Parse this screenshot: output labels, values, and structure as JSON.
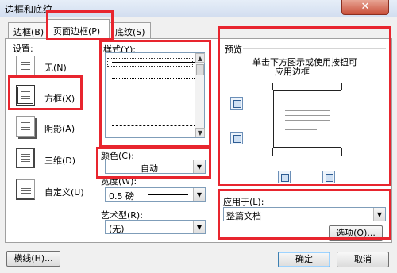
{
  "window": {
    "title": "边框和底纹",
    "close_glyph": "✕"
  },
  "tabs": [
    {
      "label": "边框(B)",
      "active": false
    },
    {
      "label": "页面边框(P)",
      "active": true
    },
    {
      "label": "底纹(S)",
      "active": false
    }
  ],
  "settings": {
    "heading": "设置:",
    "items": [
      {
        "label": "无(N)",
        "icon": "none-border-icon"
      },
      {
        "label": "方框(X)",
        "icon": "box-border-icon",
        "selected": true
      },
      {
        "label": "阴影(A)",
        "icon": "shadow-border-icon"
      },
      {
        "label": "三维(D)",
        "icon": "3d-border-icon"
      },
      {
        "label": "自定义(U)",
        "icon": "custom-border-icon"
      }
    ]
  },
  "line_style": {
    "label": "样式(Y):"
  },
  "color": {
    "label": "颜色(C):",
    "value": "自动"
  },
  "width": {
    "label": "宽度(W):",
    "value": "0.5 磅"
  },
  "art": {
    "label": "艺术型(R):",
    "value": "(无)"
  },
  "preview": {
    "heading": "预览",
    "hint_line1": "单击下方图示或使用按钮可",
    "hint_line2": "应用边框"
  },
  "apply_to": {
    "label": "应用于(L):",
    "value": "整篇文档",
    "options_button": "选项(O)..."
  },
  "footer": {
    "horizontal_line_button": "横线(H)...",
    "ok_button": "确定",
    "cancel_button": "取消"
  },
  "colors": {
    "highlight_red": "#e8252e",
    "title_gradient_top": "#e6eef8",
    "close_button": "#c9503a"
  }
}
